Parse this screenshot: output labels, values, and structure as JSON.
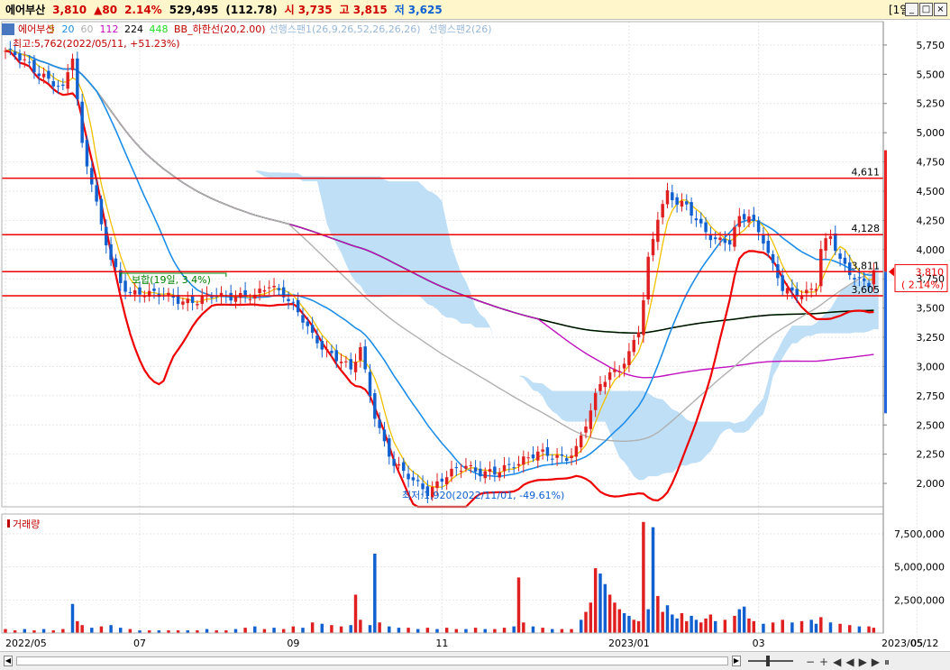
{
  "window": {
    "title": "에어부산",
    "price": "3,810",
    "change": "▲80",
    "change_pct": "2.14%",
    "volume": "529,495",
    "volume_ratio": "(112.78)",
    "open_label": "시",
    "open": "3,735",
    "high_label": "고",
    "high": "3,815",
    "low_label": "저",
    "low": "3,625",
    "period": "[1일]",
    "btn_min": "_",
    "btn_max": "□",
    "btn_close": "×"
  },
  "price_legend": {
    "name": "에어부산",
    "ma": [
      "5",
      "20",
      "60",
      "112",
      "224",
      "448"
    ],
    "bb": "BB_하한선(20,2.00)",
    "span1": "선행스팬1(26,9,26,52,26,26,26)",
    "span2": "선행스팬2(26)"
  },
  "annotations": {
    "max": "최고:5,762(2022/05/11, +51.23%)",
    "min": "최저:1,920(2022/11/01, -49.61%)",
    "box": "보합(19일, 3.4%)"
  },
  "hlines": [
    {
      "value": 4611,
      "label": "4,611"
    },
    {
      "value": 4128,
      "label": "4,128"
    },
    {
      "value": 3811,
      "label": "3,811"
    },
    {
      "value": 3605,
      "label": "3,605"
    }
  ],
  "current": {
    "price_label": "3,810",
    "pct_label": "( 2.14%)",
    "value": 3810
  },
  "volume_legend": "거래량",
  "colors": {
    "up": "#e02020",
    "down": "#1060d0",
    "ma5": "#f0c000",
    "ma20": "#1e8ee8",
    "ma60": "#b0b0b0",
    "ma112": "#c010c0",
    "ma224": "#000000",
    "ma448": "#22dd22",
    "bb": "#ee0000",
    "cloud": "#b8dcf6",
    "hline": "#ee0000"
  },
  "chart_data": {
    "type": "candlestick",
    "x_ticks": [
      "2022/05",
      "07",
      "09",
      "11",
      "2023/01",
      "03",
      "05",
      "2023/05/12"
    ],
    "price_axis": {
      "ylim": [
        1800,
        5950
      ],
      "ticks": [
        "5,750",
        "5,500",
        "5,250",
        "5,000",
        "4,750",
        "4,500",
        "4,250",
        "4,000",
        "3,750",
        "3,500",
        "3,250",
        "3,000",
        "2,750",
        "2,500",
        "2,250",
        "2,000"
      ]
    },
    "volume_axis": {
      "ylim": [
        0,
        9000000
      ],
      "ticks": [
        "7,500,000",
        "5,000,000",
        "2,500,000"
      ]
    },
    "trend_close": [
      [
        0,
        5700
      ],
      [
        4,
        5600
      ],
      [
        8,
        5500
      ],
      [
        12,
        5350
      ],
      [
        14,
        5650
      ],
      [
        16,
        4900
      ],
      [
        18,
        4600
      ],
      [
        20,
        4200
      ],
      [
        22,
        3900
      ],
      [
        24,
        3700
      ],
      [
        26,
        3640
      ],
      [
        28,
        3650
      ],
      [
        32,
        3600
      ],
      [
        36,
        3580
      ],
      [
        40,
        3560
      ],
      [
        44,
        3600
      ],
      [
        48,
        3620
      ],
      [
        52,
        3580
      ],
      [
        55,
        3700
      ],
      [
        58,
        3640
      ],
      [
        61,
        3450
      ],
      [
        64,
        3250
      ],
      [
        67,
        3150
      ],
      [
        70,
        3050
      ],
      [
        72,
        2950
      ],
      [
        74,
        3150
      ],
      [
        75,
        2950
      ],
      [
        77,
        2600
      ],
      [
        79,
        2350
      ],
      [
        81,
        2150
      ],
      [
        83,
        2080
      ],
      [
        85,
        2030
      ],
      [
        87,
        1980
      ],
      [
        88,
        1940
      ],
      [
        90,
        1990
      ],
      [
        93,
        2080
      ],
      [
        96,
        2170
      ],
      [
        99,
        2100
      ],
      [
        102,
        2070
      ],
      [
        105,
        2150
      ],
      [
        108,
        2220
      ],
      [
        111,
        2250
      ],
      [
        114,
        2220
      ],
      [
        117,
        2240
      ],
      [
        119,
        2300
      ],
      [
        122,
        2600
      ],
      [
        124,
        2850
      ],
      [
        126,
        2950
      ],
      [
        128,
        3000
      ],
      [
        130,
        3100
      ],
      [
        132,
        3300
      ],
      [
        133,
        3550
      ],
      [
        134,
        3900
      ],
      [
        136,
        4300
      ],
      [
        138,
        4500
      ],
      [
        140,
        4400
      ],
      [
        142,
        4350
      ],
      [
        145,
        4200
      ],
      [
        148,
        4100
      ],
      [
        151,
        4050
      ],
      [
        153,
        4250
      ],
      [
        155,
        4300
      ],
      [
        158,
        4100
      ],
      [
        160,
        3850
      ],
      [
        162,
        3650
      ],
      [
        164,
        3620
      ],
      [
        167,
        3650
      ],
      [
        169,
        3700
      ],
      [
        170,
        4000
      ],
      [
        172,
        4100
      ],
      [
        174,
        3900
      ],
      [
        176,
        3820
      ],
      [
        178,
        3750
      ],
      [
        180,
        3700
      ],
      [
        181,
        3810
      ]
    ],
    "volume_bars": [
      [
        0,
        0.3
      ],
      [
        2,
        0.2
      ],
      [
        4,
        0.3
      ],
      [
        6,
        0.2
      ],
      [
        8,
        0.3
      ],
      [
        10,
        0.2
      ],
      [
        12,
        0.3
      ],
      [
        14,
        2.2
      ],
      [
        15,
        0.9
      ],
      [
        16,
        0.6
      ],
      [
        18,
        0.4
      ],
      [
        20,
        0.5
      ],
      [
        22,
        0.6
      ],
      [
        24,
        0.4
      ],
      [
        26,
        0.3
      ],
      [
        28,
        0.2
      ],
      [
        30,
        0.2
      ],
      [
        32,
        0.2
      ],
      [
        34,
        0.2
      ],
      [
        36,
        0.2
      ],
      [
        38,
        0.2
      ],
      [
        40,
        0.2
      ],
      [
        42,
        0.3
      ],
      [
        44,
        0.2
      ],
      [
        46,
        0.2
      ],
      [
        48,
        0.3
      ],
      [
        50,
        0.4
      ],
      [
        52,
        0.5
      ],
      [
        54,
        0.3
      ],
      [
        56,
        0.4
      ],
      [
        58,
        0.3
      ],
      [
        60,
        0.5
      ],
      [
        62,
        0.4
      ],
      [
        64,
        0.8
      ],
      [
        66,
        0.7
      ],
      [
        68,
        0.6
      ],
      [
        70,
        0.5
      ],
      [
        72,
        0.6
      ],
      [
        73,
        2.9
      ],
      [
        74,
        1.0
      ],
      [
        76,
        0.6
      ],
      [
        77,
        6.0
      ],
      [
        78,
        0.8
      ],
      [
        80,
        0.5
      ],
      [
        82,
        0.4
      ],
      [
        84,
        0.4
      ],
      [
        86,
        0.3
      ],
      [
        88,
        0.4
      ],
      [
        90,
        0.3
      ],
      [
        92,
        0.4
      ],
      [
        94,
        0.3
      ],
      [
        96,
        0.3
      ],
      [
        98,
        0.4
      ],
      [
        100,
        0.3
      ],
      [
        102,
        0.3
      ],
      [
        104,
        0.4
      ],
      [
        106,
        0.5
      ],
      [
        107,
        4.2
      ],
      [
        108,
        0.8
      ],
      [
        110,
        0.5
      ],
      [
        112,
        0.4
      ],
      [
        114,
        0.3
      ],
      [
        116,
        0.3
      ],
      [
        118,
        0.3
      ],
      [
        120,
        1.0
      ],
      [
        121,
        1.6
      ],
      [
        122,
        2.3
      ],
      [
        123,
        4.9
      ],
      [
        124,
        4.5
      ],
      [
        125,
        3.7
      ],
      [
        126,
        2.9
      ],
      [
        127,
        2.3
      ],
      [
        128,
        1.8
      ],
      [
        129,
        1.5
      ],
      [
        130,
        1.3
      ],
      [
        131,
        1.0
      ],
      [
        132,
        0.9
      ],
      [
        133,
        8.4
      ],
      [
        134,
        1.8
      ],
      [
        135,
        8.0
      ],
      [
        136,
        2.8
      ],
      [
        137,
        1.6
      ],
      [
        138,
        2.1
      ],
      [
        139,
        1.4
      ],
      [
        140,
        1.1
      ],
      [
        141,
        1.5
      ],
      [
        142,
        0.9
      ],
      [
        143,
        1.3
      ],
      [
        144,
        1.0
      ],
      [
        145,
        0.8
      ],
      [
        146,
        1.1
      ],
      [
        147,
        1.4
      ],
      [
        148,
        0.9
      ],
      [
        150,
        1.0
      ],
      [
        152,
        1.3
      ],
      [
        153,
        1.8
      ],
      [
        154,
        2.0
      ],
      [
        155,
        1.1
      ],
      [
        156,
        0.9
      ],
      [
        158,
        0.7
      ],
      [
        160,
        0.8
      ],
      [
        162,
        1.0
      ],
      [
        164,
        0.8
      ],
      [
        166,
        0.9
      ],
      [
        168,
        1.0
      ],
      [
        169,
        0.7
      ],
      [
        170,
        1.2
      ],
      [
        172,
        0.8
      ],
      [
        174,
        0.7
      ],
      [
        176,
        0.6
      ],
      [
        178,
        0.5
      ],
      [
        180,
        0.5
      ],
      [
        181,
        0.4
      ]
    ]
  }
}
